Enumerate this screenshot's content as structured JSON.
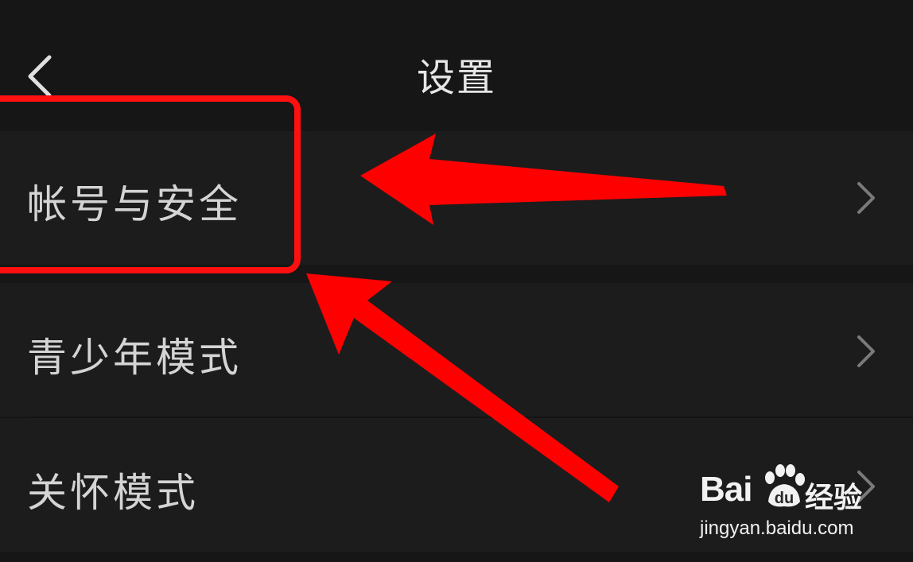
{
  "header": {
    "title": "设置",
    "back_icon": "chevron-left-icon"
  },
  "settings": {
    "items": [
      {
        "label": "帐号与安全",
        "icon": "chevron-right-icon"
      },
      {
        "label": "青少年模式",
        "icon": "chevron-right-icon"
      },
      {
        "label": "关怀模式",
        "icon": "chevron-right-icon"
      }
    ]
  },
  "annotation": {
    "color": "#ff0000",
    "highlighted_item": "帐号与安全"
  },
  "watermark": {
    "brand": "Bai",
    "brand_suffix": "du",
    "product": "经验",
    "url": "jingyan.baidu.com"
  },
  "colors": {
    "background": "#161616",
    "row": "#1c1c1c",
    "text": "#d4d4d4",
    "chevron": "#7a7a7a"
  }
}
